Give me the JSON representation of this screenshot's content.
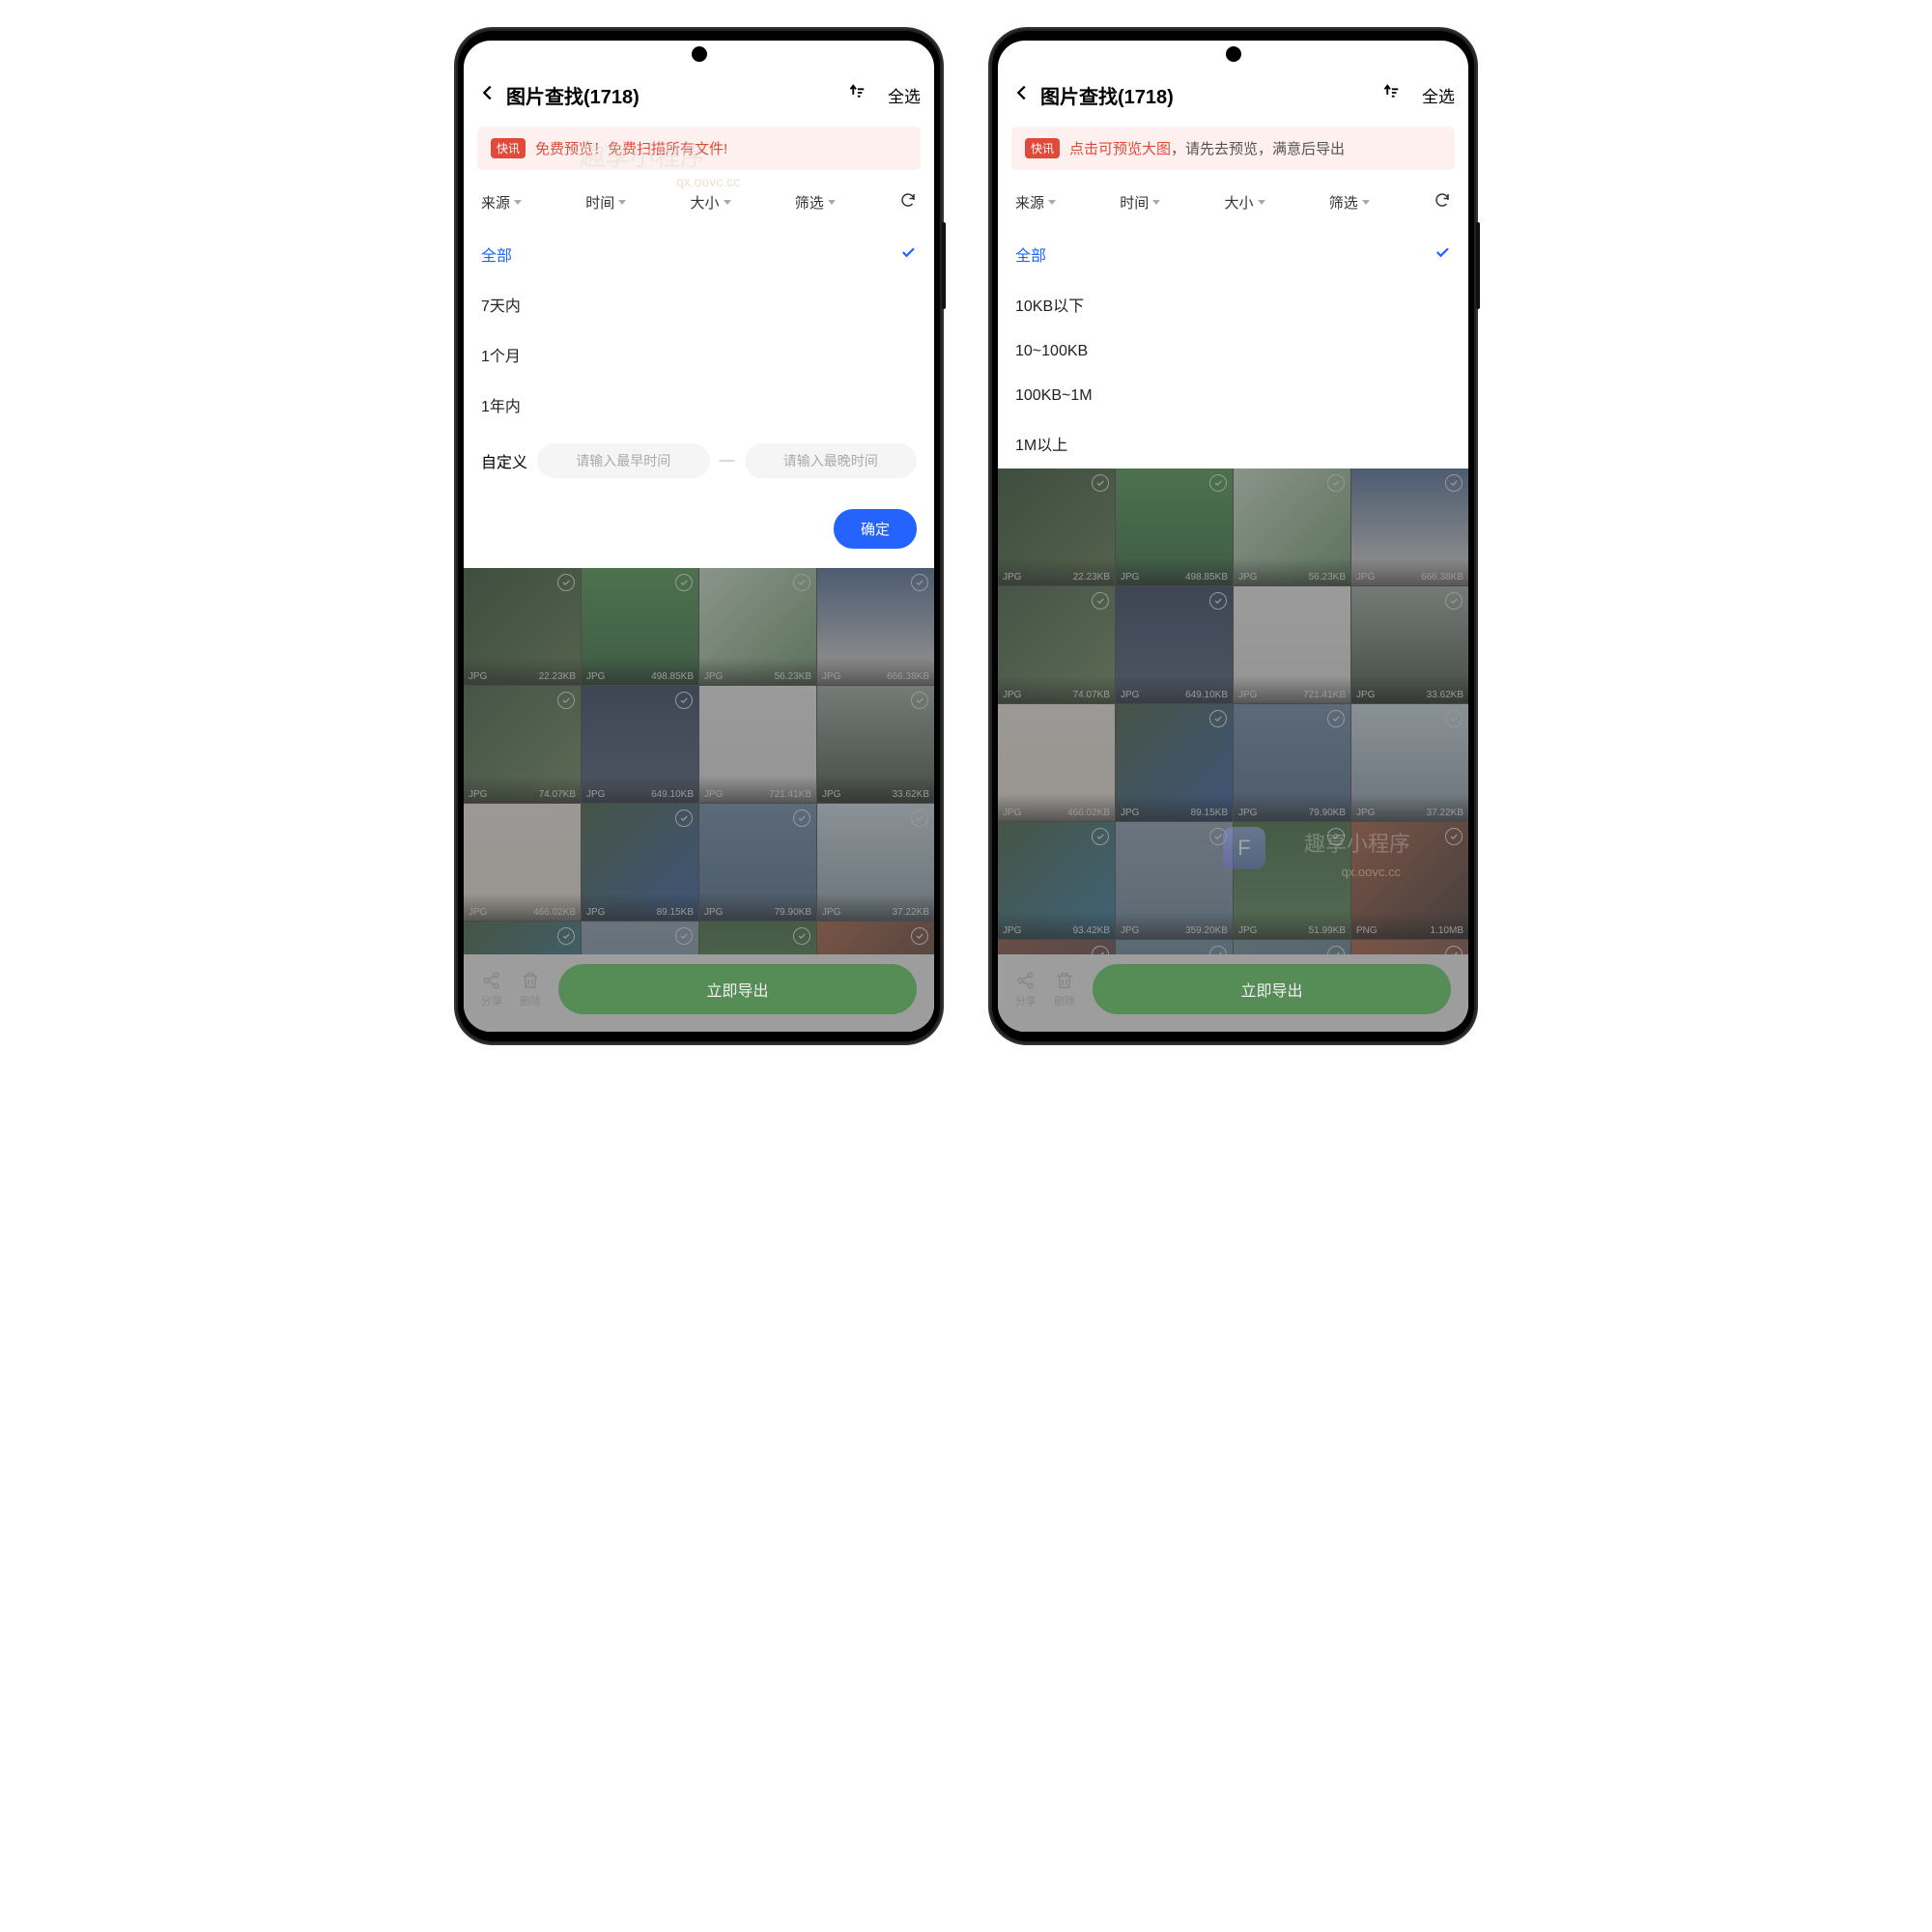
{
  "header": {
    "title": "图片查找(1718)",
    "select_all": "全选"
  },
  "banner1": {
    "badge": "快讯",
    "text_red_a": "免费预览！",
    "text_red_b": "免费扫描所有文件!"
  },
  "banner2": {
    "badge": "快讯",
    "text_red": "点击可预览大图",
    "text_gray": "，请先去预览，满意后导出"
  },
  "filters": {
    "source": "来源",
    "time": "时间",
    "size": "大小",
    "filter": "筛选"
  },
  "time_panel": {
    "all": "全部",
    "w1": "7天内",
    "m1": "1个月",
    "y1": "1年内",
    "custom": "自定义",
    "ph_early": "请输入最早时间",
    "ph_late": "请输入最晚时间",
    "confirm": "确定"
  },
  "size_panel": {
    "all": "全部",
    "s1": "10KB以下",
    "s2": "10~100KB",
    "s3": "100KB~1M",
    "s4": "1M以上"
  },
  "grid_rows": [
    [
      {
        "fmt": "JPG",
        "sz": "22.23KB",
        "bg": "linear-gradient(135deg,#2a4a2a,#5a7a4a)"
      },
      {
        "fmt": "JPG",
        "sz": "498.85KB",
        "bg": "linear-gradient(180deg,#4a9a4a,#2a6a3a)"
      },
      {
        "fmt": "JPG",
        "sz": "56.23KB",
        "bg": "linear-gradient(135deg,#d0e8d0,#6a9a6a)"
      },
      {
        "fmt": "JPG",
        "sz": "666.38KB",
        "bg": "linear-gradient(180deg,#4a6a9a,#f0e8e0)"
      }
    ],
    [
      {
        "fmt": "JPG",
        "sz": "74.07KB",
        "bg": "linear-gradient(135deg,#3a5a3a,#6a8a5a)"
      },
      {
        "fmt": "JPG",
        "sz": "649.10KB",
        "bg": "linear-gradient(180deg,#2a3a5a,#4a5a7a)"
      },
      {
        "fmt": "JPG",
        "sz": "721.41KB",
        "bg": "linear-gradient(180deg,#f5f5f5,#e8e8e8)"
      },
      {
        "fmt": "JPG",
        "sz": "33.62KB",
        "bg": "linear-gradient(180deg,#a0b0a8,#3a4a3a)"
      }
    ],
    [
      {
        "fmt": "JPG",
        "sz": "466.02KB",
        "bg": "linear-gradient(180deg,#f5f0ea,#f0e8dc)"
      },
      {
        "fmt": "JPG",
        "sz": "89.15KB",
        "bg": "linear-gradient(135deg,#3a5a3a,#2a5aaa)"
      },
      {
        "fmt": "JPG",
        "sz": "79.90KB",
        "bg": "linear-gradient(180deg,#6a8aaa,#4a6a8a)"
      },
      {
        "fmt": "JPG",
        "sz": "37.22KB",
        "bg": "linear-gradient(180deg,#d0e0ea,#8aa0b0)"
      }
    ],
    [
      {
        "fmt": "JPG",
        "sz": "93.42KB",
        "bg": "linear-gradient(135deg,#3a5a3a,#2a7aaa)"
      },
      {
        "fmt": "JPG",
        "sz": "359.20KB",
        "bg": "linear-gradient(180deg,#8aa0b8,#6a8aa0)"
      },
      {
        "fmt": "JPG",
        "sz": "51.99KB",
        "bg": "linear-gradient(180deg,#3a6a3a,#5a8a5a)"
      },
      {
        "fmt": "PNG",
        "sz": "1.10MB",
        "bg": "linear-gradient(135deg,#aa5a3a,#3a2a2a)"
      }
    ],
    [
      {
        "fmt": "",
        "sz": "",
        "bg": "linear-gradient(135deg,#8a4a3a,#3a3a4a)"
      },
      {
        "fmt": "",
        "sz": "",
        "bg": "linear-gradient(180deg,#6a8aa0,#4a6a8a)"
      },
      {
        "fmt": "",
        "sz": "",
        "bg": "linear-gradient(135deg,#6a8a9a,#5a7a8a)"
      },
      {
        "fmt": "",
        "sz": "",
        "bg": "linear-gradient(135deg,#aa5a3a,#5a3a3a)"
      }
    ]
  ],
  "bottom": {
    "share": "分享",
    "delete": "删除",
    "export": "立即导出"
  },
  "watermark": {
    "big": "趣享小程序",
    "small": "qx.oovc.cc",
    "f": "F"
  }
}
